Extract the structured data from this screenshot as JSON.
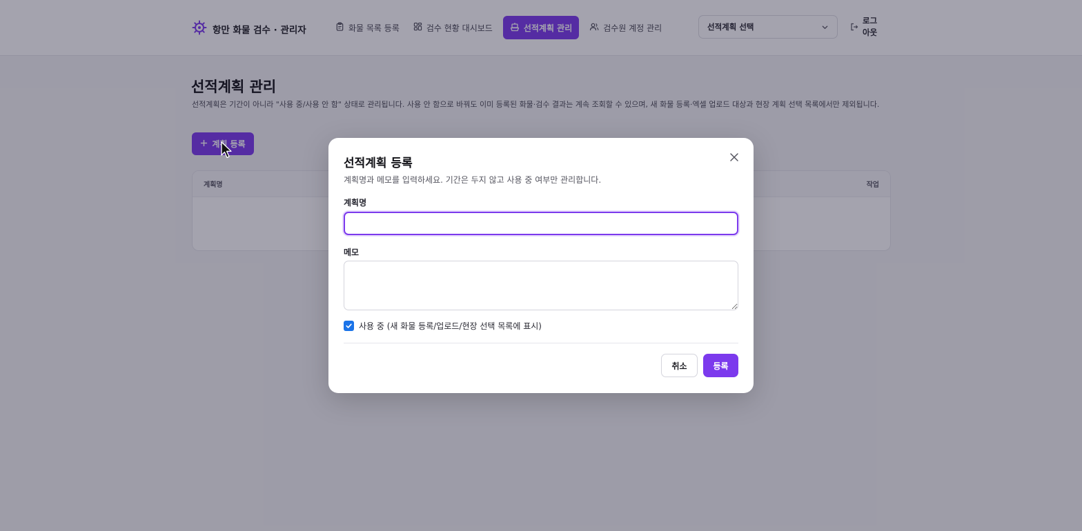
{
  "header": {
    "brand": "항만 화물 검수 · 관리자",
    "nav": [
      {
        "label": "화물 목록 등록",
        "icon": "clipboard-icon",
        "active": false
      },
      {
        "label": "검수 현황 대시보드",
        "icon": "dashboard-icon",
        "active": false
      },
      {
        "label": "선적계획 관리",
        "icon": "ship-icon",
        "active": true
      },
      {
        "label": "검수원 계정 관리",
        "icon": "users-icon",
        "active": false
      }
    ],
    "plan_select": "선적계획 선택",
    "logout": "로그아웃"
  },
  "page": {
    "title": "선적계획 관리",
    "description": "선적계획은 기간이 아니라 \"사용 중/사용 안 함\" 상태로 관리됩니다. 사용 안 함으로 바꿔도 이미 등록된 화물·검수 결과는 계속 조회할 수 있으며, 새 화물 등록·엑셀 업로드 대상과 현장 계획 선택 목록에서만 제외됩니다.",
    "add_button": "계획 등록",
    "table": {
      "col_name": "계획명",
      "col_action": "작업"
    }
  },
  "modal": {
    "title": "선적계획 등록",
    "description": "계획명과 메모를 입력하세요. 기간은 두지 않고 사용 중 여부만 관리합니다.",
    "name_label": "계획명",
    "name_value": "",
    "memo_label": "메모",
    "memo_value": "",
    "active_checked": true,
    "active_label": "사용 중 (새 화물 등록/업로드/현장 선택 목록에 표시)",
    "cancel": "취소",
    "submit": "등록"
  },
  "colors": {
    "accent": "#7c3aed",
    "checkbox": "#1a73e8"
  }
}
